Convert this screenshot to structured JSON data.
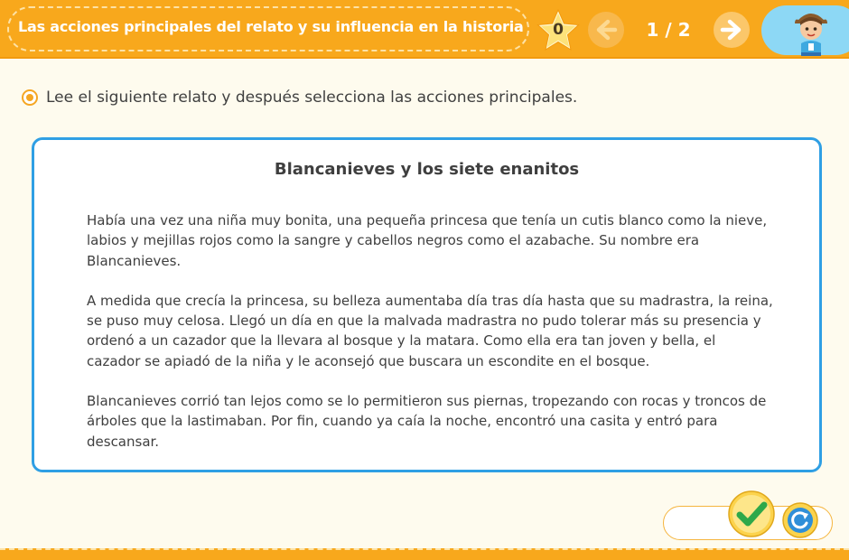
{
  "header": {
    "title": "Las acciones principales del relato y su influencia en la historia",
    "star_count": "0",
    "page_counter": "1 / 2",
    "icons": {
      "star": "star-icon",
      "prev": "arrow-left-icon",
      "next": "arrow-right-icon",
      "avatar": "boy-avatar-icon"
    }
  },
  "instruction": "Lee el siguiente relato y después selecciona las acciones principales.",
  "story": {
    "title": "Blancanieves y los siete enanitos",
    "paragraphs": [
      "Había una vez una niña muy bonita, una pequeña princesa que tenía un cutis blanco como la nieve, labios y mejillas rojos como la sangre y cabellos negros como el azabache. Su nombre era Blancanieves.",
      "A medida que crecía la princesa, su belleza aumentaba día tras día hasta que su madrastra, la reina, se puso muy celosa. Llegó un día en que la malvada madrastra no pudo tolerar más su presencia y ordenó a un cazador que la llevara al bosque y la matara. Como ella era tan joven y bella, el cazador se apiadó de la niña y le aconsejó que buscara un escondite en el bosque.",
      "Blancanieves corrió tan lejos como se lo permitieron sus piernas, tropezando con rocas y troncos de árboles que la lastimaban. Por fin, cuando ya caía la noche, encontró una casita y entró para descansar."
    ]
  },
  "controls": {
    "check_icon": "checkmark-icon",
    "reset_icon": "refresh-icon"
  },
  "colors": {
    "header_orange": "#f8a81c",
    "card_border_blue": "#2f9fe4",
    "check_green": "#2ea84a",
    "background": "#fefbee"
  }
}
